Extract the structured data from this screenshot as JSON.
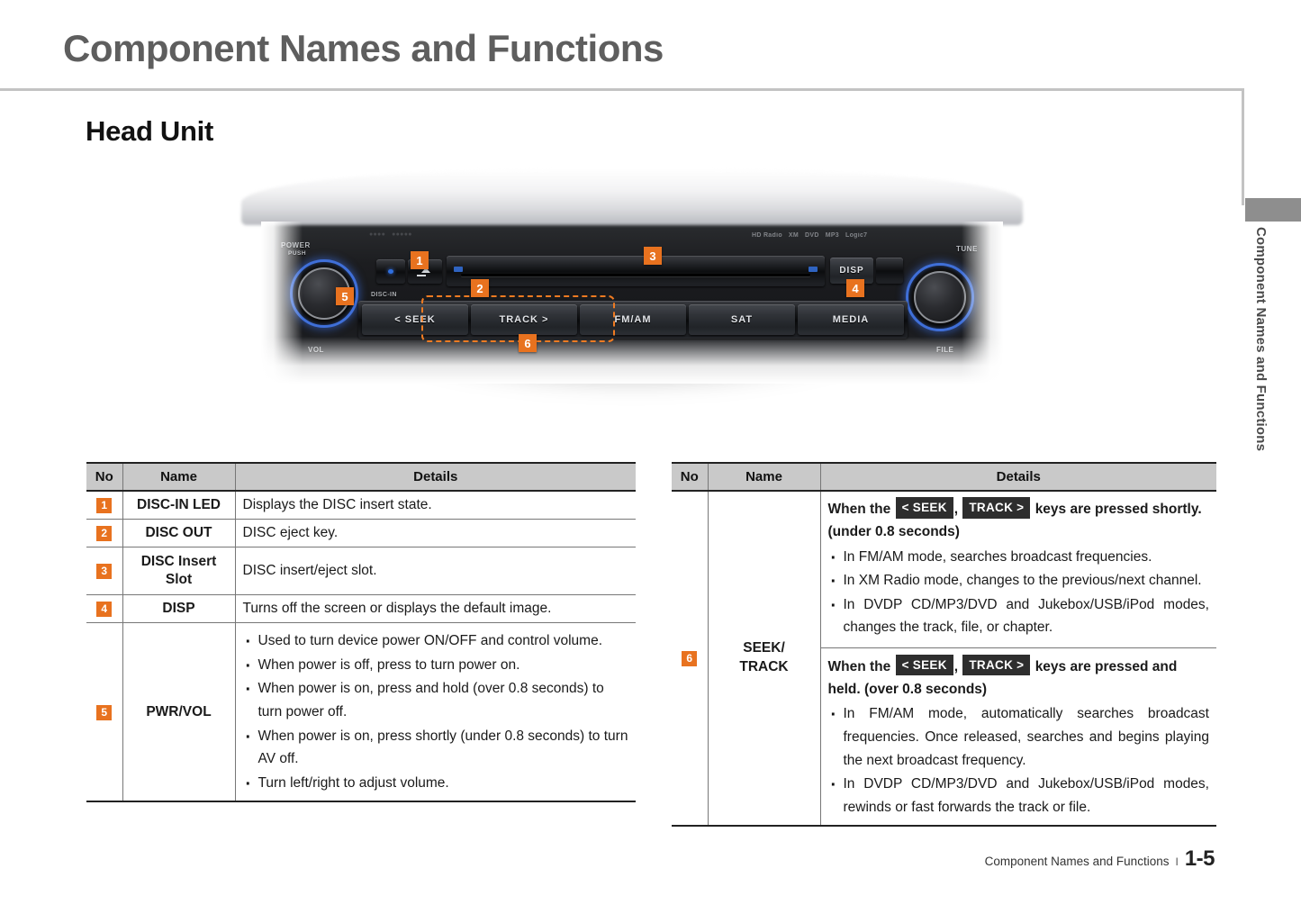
{
  "page_title": "Component Names and Functions",
  "section_heading": "Head Unit",
  "side_tab_label": "Component Names and Functions",
  "footer": {
    "chapter": "Component Names and Functions",
    "separator": "I",
    "page": "1-5"
  },
  "head_unit": {
    "power_label_line1": "POWER",
    "power_label_line2": "PUSH",
    "vol_label": "VOL",
    "tune_label": "TUNE",
    "file_label": "FILE",
    "disc_in_label": "DISC-IN",
    "disp_label": "DISP",
    "eject_icon": "eject-icon",
    "led_icon": "disc-in-led-icon",
    "logo_badges": [
      "HD Radio",
      "XM",
      "DVD",
      "MP3",
      "Logic7"
    ],
    "buttons": [
      {
        "label": "< SEEK",
        "name": "seek-button"
      },
      {
        "label": "TRACK >",
        "name": "track-button"
      },
      {
        "label": "FM/AM",
        "name": "fm-am-button"
      },
      {
        "label": "SAT",
        "name": "sat-button"
      },
      {
        "label": "MEDIA",
        "name": "media-button"
      }
    ],
    "markers": [
      "1",
      "2",
      "3",
      "4",
      "5",
      "6"
    ]
  },
  "left_table": {
    "headers": [
      "No",
      "Name",
      "Details"
    ],
    "rows": [
      {
        "no": "1",
        "name": "DISC-IN LED",
        "details": "Displays the DISC insert state."
      },
      {
        "no": "2",
        "name": "DISC OUT",
        "details": "DISC eject key."
      },
      {
        "no": "3",
        "name": "DISC Insert Slot",
        "details": "DISC insert/eject slot."
      },
      {
        "no": "4",
        "name": "DISP",
        "details": "Turns off the screen or displays the default image."
      },
      {
        "no": "5",
        "name": "PWR/VOL",
        "details": [
          "Used to turn device power ON/OFF and control volume.",
          "When power is off, press to turn power on.",
          "When power is on, press and hold (over 0.8 seconds) to turn power off.",
          "When power is on, press shortly (under 0.8 seconds) to turn AV off.",
          "Turn left/right to adjust volume."
        ]
      }
    ]
  },
  "right_table": {
    "headers": [
      "No",
      "Name",
      "Details"
    ],
    "row": {
      "no": "6",
      "name_line1": "SEEK/",
      "name_line2": "TRACK",
      "short_press": {
        "lead_a": "When the",
        "chip_1": "< SEEK",
        "comma": ",",
        "chip_2": "TRACK >",
        "lead_b": "keys are pressed shortly. (under 0.8 seconds)",
        "bullets": [
          "In FM/AM mode, searches broadcast frequencies.",
          "In XM Radio mode, changes to the previous/next channel.",
          "In DVDP CD/MP3/DVD and Jukebox/USB/iPod modes, changes the track, file, or chapter."
        ]
      },
      "long_press": {
        "lead_a": "When the",
        "chip_1": "< SEEK",
        "comma": ",",
        "chip_2": "TRACK >",
        "lead_b": "keys are pressed and held. (over 0.8 seconds)",
        "bullets": [
          "In FM/AM mode, automatically searches broadcast frequencies. Once released, searches and begins playing the next broadcast frequency.",
          "In DVDP CD/MP3/DVD and Jukebox/USB/iPod modes, rewinds or fast forwards the track or file."
        ]
      }
    }
  },
  "colors": {
    "accent_orange": "#e8721f",
    "header_gray": "#c9c9c9",
    "title_gray": "#5e5e5e",
    "knob_blue": "#3f6fd8"
  }
}
